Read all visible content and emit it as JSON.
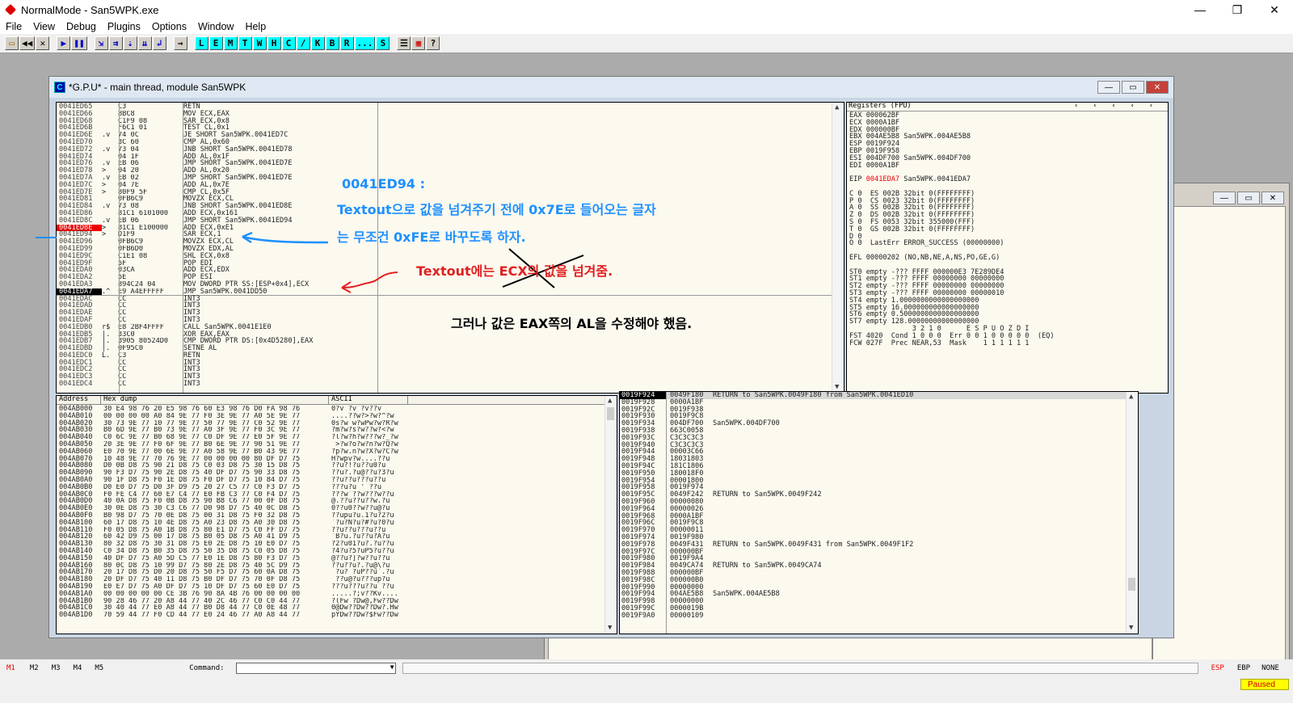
{
  "window": {
    "title": "NormalMode - San5WPK.exe",
    "min": "—",
    "max": "❐",
    "close": "✕"
  },
  "menu": [
    "File",
    "View",
    "Debug",
    "Plugins",
    "Options",
    "Window",
    "Help"
  ],
  "toolbar": [
    "L",
    "E",
    "M",
    "T",
    "W",
    "H",
    "C",
    "/",
    "K",
    "B",
    "R",
    "...",
    "S"
  ],
  "cpu": {
    "title": "*G.P.U* - main thread, module San5WPK",
    "icon_letter": "C",
    "disasm": [
      {
        "addr": "0041ED65",
        "arr": "",
        "hex": "C3",
        "cmd": "RETN"
      },
      {
        "addr": "0041ED66",
        "arr": "",
        "hex": "8BC8",
        "cmd": "MOV ECX,EAX"
      },
      {
        "addr": "0041ED68",
        "arr": "",
        "hex": "C1F9 08",
        "cmd": "SAR ECX,0x8"
      },
      {
        "addr": "0041ED6B",
        "arr": "",
        "hex": "F6C1 01",
        "cmd": "TEST CL,0x1"
      },
      {
        "addr": "0041ED6E",
        "arr": ".v",
        "hex": "74 0C",
        "cmd": "JE SHORT San5WPK.0041ED7C"
      },
      {
        "addr": "0041ED70",
        "arr": "",
        "hex": "3C 60",
        "cmd": "CMP AL,0x60"
      },
      {
        "addr": "0041ED72",
        "arr": ".v",
        "hex": "73 04",
        "cmd": "JNB SHORT San5WPK.0041ED78"
      },
      {
        "addr": "0041ED74",
        "arr": "",
        "hex": "04 1F",
        "cmd": "ADD AL,0x1F"
      },
      {
        "addr": "0041ED76",
        "arr": ".v",
        "hex": "EB 06",
        "cmd": "JMP SHORT San5WPK.0041ED7E"
      },
      {
        "addr": "0041ED78",
        "arr": ">",
        "hex": "04 20",
        "cmd": "ADD AL,0x20"
      },
      {
        "addr": "0041ED7A",
        "arr": ".v",
        "hex": "EB 02",
        "cmd": "JMP SHORT San5WPK.0041ED7E"
      },
      {
        "addr": "0041ED7C",
        "arr": ">",
        "hex": "04 7E",
        "cmd": "ADD AL,0x7E"
      },
      {
        "addr": "0041ED7E",
        "arr": ">",
        "hex": "80F9 5F",
        "cmd": "CMP CL,0x5F"
      },
      {
        "addr": "0041ED81",
        "arr": "",
        "hex": "0FB6C9",
        "cmd": "MOVZX ECX,CL"
      },
      {
        "addr": "0041ED84",
        "arr": ".v",
        "hex": "73 08",
        "cmd": "JNB SHORT San5WPK.0041ED8E"
      },
      {
        "addr": "0041ED86",
        "arr": "",
        "hex": "81C1 6101000",
        "cmd": "ADD ECX,0x161"
      },
      {
        "addr": "0041ED8C",
        "arr": ".v",
        "hex": "EB 06",
        "cmd": "JMP SHORT San5WPK.0041ED94"
      },
      {
        "addr": "0041ED8E",
        "arr": ">",
        "hex": "81C1 E100000",
        "cmd": "ADD ECX,0xE1",
        "bp": true
      },
      {
        "addr": "0041ED94",
        "arr": ">",
        "hex": "D1F9",
        "cmd": "SAR ECX,1"
      },
      {
        "addr": "0041ED96",
        "arr": "",
        "hex": "0FB6C9",
        "cmd": "MOVZX ECX,CL"
      },
      {
        "addr": "0041ED99",
        "arr": "",
        "hex": "0FB6D0",
        "cmd": "MOVZX EDX,AL"
      },
      {
        "addr": "0041ED9C",
        "arr": "",
        "hex": "C1E1 08",
        "cmd": "SHL ECX,0x8"
      },
      {
        "addr": "0041ED9F",
        "arr": "",
        "hex": "5F",
        "cmd": "POP EDI"
      },
      {
        "addr": "0041EDA0",
        "arr": "",
        "hex": "03CA",
        "cmd": "ADD ECX,EDX"
      },
      {
        "addr": "0041EDA2",
        "arr": "",
        "hex": "5E",
        "cmd": "POP ESI"
      },
      {
        "addr": "0041EDA3",
        "arr": "",
        "hex": "894C24 04",
        "cmd": "MOV DWORD PTR SS:[ESP+0x4],ECX"
      },
      {
        "addr": "0041EDA7",
        "arr": ".^",
        "hex": "E9 A4EFFFFF",
        "cmd": "JMP San5WPK.0041DD50",
        "sel": true
      },
      {
        "addr": "0041EDAC",
        "arr": "",
        "hex": "CC",
        "cmd": "INT3"
      },
      {
        "addr": "0041EDAD",
        "arr": "",
        "hex": "CC",
        "cmd": "INT3"
      },
      {
        "addr": "0041EDAE",
        "arr": "",
        "hex": "CC",
        "cmd": "INT3"
      },
      {
        "addr": "0041EDAF",
        "arr": "",
        "hex": "CC",
        "cmd": "INT3"
      },
      {
        "addr": "0041EDB0",
        "arr": "r$",
        "hex": "E8 2BF4FFFF",
        "cmd": "CALL San5WPK.0041E1E0"
      },
      {
        "addr": "0041EDB5",
        "arr": "|.",
        "hex": "33C0",
        "cmd": "XOR EAX,EAX"
      },
      {
        "addr": "0041EDB7",
        "arr": "|.",
        "hex": "3905 80524D0",
        "cmd": "CMP DWORD PTR DS:[0x4D5280],EAX"
      },
      {
        "addr": "0041EDBD",
        "arr": "|.",
        "hex": "0F95C0",
        "cmd": "SETNE AL"
      },
      {
        "addr": "0041EDC0",
        "arr": "L.",
        "hex": "C3",
        "cmd": "RETN"
      },
      {
        "addr": "0041EDC1",
        "arr": "",
        "hex": "CC",
        "cmd": "INT3"
      },
      {
        "addr": "0041EDC2",
        "arr": "",
        "hex": "CC",
        "cmd": "INT3"
      },
      {
        "addr": "0041EDC3",
        "arr": "",
        "hex": "CC",
        "cmd": "INT3"
      },
      {
        "addr": "0041EDC4",
        "arr": "",
        "hex": "CC",
        "cmd": "INT3"
      }
    ],
    "registers_header": "Registers (FPU)",
    "registers": [
      "EAX 000062BF",
      "ECX 0000A1BF",
      "EDX 000000BF",
      "EBX 004AE5B8 San5WPK.004AE5B8",
      "ESP 0019F924",
      "EBP 0019F958",
      "ESI 004DF700 San5WPK.004DF700",
      "EDI 0000A1BF",
      "",
      "EIP|0041EDA7| San5WPK.0041EDA7",
      "",
      "C 0  ES 002B 32bit 0(FFFFFFFF)",
      "P 0  CS 0023 32bit 0(FFFFFFFF)",
      "A 0  SS 002B 32bit 0(FFFFFFFF)",
      "Z 0  DS 002B 32bit 0(FFFFFFFF)",
      "S 0  FS 0053 32bit 355000(FFF)",
      "T 0  GS 002B 32bit 0(FFFFFFFF)",
      "D 0",
      "O 0  LastErr ERROR_SUCCESS (00000000)",
      "",
      "EFL 00000202 (NO,NB,NE,A,NS,PO,GE,G)",
      "",
      "ST0 empty -??? FFFF 000000E3 7E289DE4",
      "ST1 empty -??? FFFF 00000000 00000000",
      "ST2 empty -??? FFFF 00000000 00000000",
      "ST3 empty -??? FFFF 00000000 00000010",
      "ST4 empty 1.0000000000000000000",
      "ST5 empty 16.000000000000000000",
      "ST6 empty 0.5000000000000000000",
      "ST7 empty 128.00000000000000000",
      "               3 2 1 0      E S P U O Z D I",
      "FST 4020  Cond 1 0 0 0  Err 0 0 1 0 0 0 0 0  (EQ)",
      "FCW 027F  Prec NEAR,53  Mask    1 1 1 1 1 1"
    ],
    "dump_headers": {
      "address": "Address",
      "hex": "Hex dump",
      "ascii": "ASCII"
    },
    "dump": [
      {
        "a": "004AB000",
        "h": "30 E4 98 76 20 E5 98 76 60 E3 98 76 D0 FA 98 76",
        "s": "0?v ?v`?v??v"
      },
      {
        "a": "004AB010",
        "h": "00 00 00 00 A0 84 9E 77 F0 3E 9E 77 A0 5E 9E 77",
        "s": "....??w?>?w?^?w"
      },
      {
        "a": "004AB020",
        "h": "30 73 9E 77 10 77 9E 77 50 77 9E 77 C0 52 9E 77",
        "s": "0s?w w?wPw?w?R?w"
      },
      {
        "a": "004AB030",
        "h": "B0 6D 9E 77 B0 73 9E 77 A0 3F 9E 77 F0 3C 9E 77",
        "s": "?m?w?s?w??w?<?w"
      },
      {
        "a": "004AB040",
        "h": "C0 6C 9E 77 B0 68 9E 77 C0 DF 9E 77 E0 5F 9E 77",
        "s": "?l?w?h?w???w?_?w"
      },
      {
        "a": "004AB050",
        "h": "20 3E 9E 77 F0 6F 9E 77 B0 6E 9E 77 90 51 9E 77",
        "s": " >?w?o?w?n?w?Q?w"
      },
      {
        "a": "004AB060",
        "h": "E0 70 9E 77 00 6E 9E 77 A0 58 9E 77 B0 43 9E 77",
        "s": "?p?w.n?w?X?w?C?w"
      },
      {
        "a": "004AB070",
        "h": "10 48 9E 77 70 76 9E 77 00 00 00 00 80 DF D7 75",
        "s": "H?wpv?w....??u"
      },
      {
        "a": "004AB080",
        "h": "D0 0B D8 75 90 21 D8 75 C0 03 D8 75 30 15 D8 75",
        "s": "??u?!?u??u0?u"
      },
      {
        "a": "004AB090",
        "h": "90 F3 D7 75 90 2E D8 75 40 DF D7 75 90 33 D8 75",
        "s": "??u?.?u@??u?3?u"
      },
      {
        "a": "004AB0A0",
        "h": "90 1F D8 75 F0 1E D8 75 F0 DF D7 75 10 84 D7 75",
        "s": "??u??u???u??u"
      },
      {
        "a": "004AB0B0",
        "h": "D0 E0 D7 75 D0 3F D9 75 20 27 C5 77 C0 F3 D7 75",
        "s": "???u?u ' ??u"
      },
      {
        "a": "004AB0C0",
        "h": "F0 FE C4 77 60 E7 C4 77 E0 FB C3 77 C0 F4 D7 75",
        "s": "???w`??w???w??u"
      },
      {
        "a": "004AB0D0",
        "h": "40 0A D8 75 F0 0B D8 75 90 B8 C6 77 00 0F D8 75",
        "s": "@.??u??u??w.?u"
      },
      {
        "a": "004AB0E0",
        "h": "30 0E D8 75 30 C3 C6 77 D0 98 D7 75 40 0C D8 75",
        "s": "0??u0??w??u@?u"
      },
      {
        "a": "004AB0F0",
        "h": "B0 98 D7 75 70 0E D8 75 00 31 D8 75 F0 32 D8 75",
        "s": "??upu?u.1?u?2?u"
      },
      {
        "a": "004AB100",
        "h": "60 17 D8 75 10 4E D8 75 A0 23 D8 75 A0 30 D8 75",
        "s": "`?u?N?u?#?u?0?u"
      },
      {
        "a": "004AB110",
        "h": "F0 05 D8 75 A0 1B D8 75 80 E1 D7 75 C0 FF D7 75",
        "s": "??u??u???u??u"
      },
      {
        "a": "004AB120",
        "h": "60 42 D9 75 00 17 D8 75 B0 05 D8 75 A0 41 D9 75",
        "s": "`B?u.?u??u?A?u"
      },
      {
        "a": "004AB130",
        "h": "80 32 D8 75 30 31 D8 75 E0 2E D8 75 10 E0 D7 75",
        "s": "?2?u01?u?.?u??u"
      },
      {
        "a": "004AB140",
        "h": "C0 34 D8 75 B0 35 D8 75 50 35 D8 75 C0 05 D8 75",
        "s": "?4?u?5?uP5?u??u"
      },
      {
        "a": "004AB150",
        "h": "40 DF D7 75 A0 5D C5 77 E0 1E D8 75 80 F3 D7 75",
        "s": "@??u?]?w??u??u"
      },
      {
        "a": "004AB160",
        "h": "80 0C D8 75 10 99 D7 75 80 2E D8 75 40 5C D9 75",
        "s": "??u??u?.?u@\\?u"
      },
      {
        "a": "004AB170",
        "h": "20 17 D8 75 D0 20 D8 75 50 F5 D7 75 60 0A D8 75",
        "s": " ?u? ?uP??u`.?u"
      },
      {
        "a": "004AB180",
        "h": "20 DF D7 75 40 11 D8 75 B0 DF D7 75 70 0F D8 75",
        "s": " ??u@?u???up?u"
      },
      {
        "a": "004AB190",
        "h": "E0 E7 D7 75 A0 DF D7 75 10 DF D7 75 60 E0 D7 75",
        "s": "???u???u??u`??u"
      },
      {
        "a": "004AB1A0",
        "h": "00 00 00 00 00 CE 3B 76 90 8A 4B 76 00 00 00 00",
        "s": ".....?;v??Kv...."
      },
      {
        "a": "004AB1B0",
        "h": "90 28 46 77 20 A8 44 77 40 2C 46 77 C0 C0 44 77",
        "s": "?(Fw ?Dw@,Fw??Dw"
      },
      {
        "a": "004AB1C0",
        "h": "30 40 44 77 E0 A8 44 77 B0 D8 44 77 C0 0E 48 77",
        "s": "0@Dw??Dw??Dw?.Hw"
      },
      {
        "a": "004AB1D0",
        "h": "70 59 44 77 F0 CD 44 77 E0 24 46 77 A0 A8 44 77",
        "s": "pYDw??Dw?$Fw??Dw"
      }
    ],
    "stack": [
      {
        "a": "0019F924",
        "v": "0049F180",
        "c": "RETURN to San5WPK.0049F180 from San5WPK.0041ED10",
        "sel": true
      },
      {
        "a": "0019F928",
        "v": "0000A1BF",
        "c": ""
      },
      {
        "a": "0019F92C",
        "v": "0019F938",
        "c": ""
      },
      {
        "a": "0019F930",
        "v": "0019F9C8",
        "c": ""
      },
      {
        "a": "0019F934",
        "v": "004DF700",
        "c": "San5WPK.004DF700"
      },
      {
        "a": "0019F938",
        "v": "663C0058",
        "c": ""
      },
      {
        "a": "0019F93C",
        "v": "C3C3C3C3",
        "c": ""
      },
      {
        "a": "0019F940",
        "v": "C3C3C3C3",
        "c": ""
      },
      {
        "a": "0019F944",
        "v": "00003C66",
        "c": ""
      },
      {
        "a": "0019F948",
        "v": "18031803",
        "c": ""
      },
      {
        "a": "0019F94C",
        "v": "181C1806",
        "c": ""
      },
      {
        "a": "0019F950",
        "v": "180018F0",
        "c": ""
      },
      {
        "a": "0019F954",
        "v": "00001800",
        "c": ""
      },
      {
        "a": "0019F958",
        "v": "0019F974",
        "c": ""
      },
      {
        "a": "0019F95C",
        "v": "0049F242",
        "c": "RETURN to San5WPK.0049F242"
      },
      {
        "a": "0019F960",
        "v": "00000080",
        "c": ""
      },
      {
        "a": "0019F964",
        "v": "00000026",
        "c": ""
      },
      {
        "a": "0019F968",
        "v": "0000A1BF",
        "c": ""
      },
      {
        "a": "0019F96C",
        "v": "0019F9C8",
        "c": ""
      },
      {
        "a": "0019F970",
        "v": "00000011",
        "c": ""
      },
      {
        "a": "0019F974",
        "v": "0019F980",
        "c": ""
      },
      {
        "a": "0019F978",
        "v": "0049F431",
        "c": "RETURN to San5WPK.0049F431 from San5WPK.0049F1F2"
      },
      {
        "a": "0019F97C",
        "v": "000000BF",
        "c": ""
      },
      {
        "a": "0019F980",
        "v": "0019F9A4",
        "c": ""
      },
      {
        "a": "0019F984",
        "v": "0049CA74",
        "c": "RETURN to San5WPK.0049CA74"
      },
      {
        "a": "0019F988",
        "v": "000000BF",
        "c": ""
      },
      {
        "a": "0019F98C",
        "v": "000000B0",
        "c": ""
      },
      {
        "a": "0019F990",
        "v": "00000000",
        "c": ""
      },
      {
        "a": "0019F994",
        "v": "004AE5B8",
        "c": "San5WPK.004AE5B8"
      },
      {
        "a": "0019F998",
        "v": "00000000",
        "c": ""
      },
      {
        "a": "0019F99C",
        "v": "0000019B",
        "c": ""
      },
      {
        "a": "0019F9A0",
        "v": "00000109",
        "c": ""
      }
    ]
  },
  "annotations": {
    "line1": "0041ED94 :",
    "line2": "Textout으로 값을 넘겨주기 전에 0x7E로 들어오는 글자",
    "line3": "는 무조건 0xFE로 바꾸도록 하자.",
    "line4": "Textout에는 ECX의 값을 넘겨줌.",
    "line5": "그러나 값은 EAX쪽의 AL을 수정해야 했음.",
    "blue": "#1e90ff",
    "red": "#e02020"
  },
  "status": {
    "marks": [
      "M1",
      "M2",
      "M3",
      "M4",
      "M5"
    ],
    "command_label": "Command:",
    "regs": [
      "ESP",
      "EBP",
      "NONE"
    ],
    "state": "Paused"
  }
}
